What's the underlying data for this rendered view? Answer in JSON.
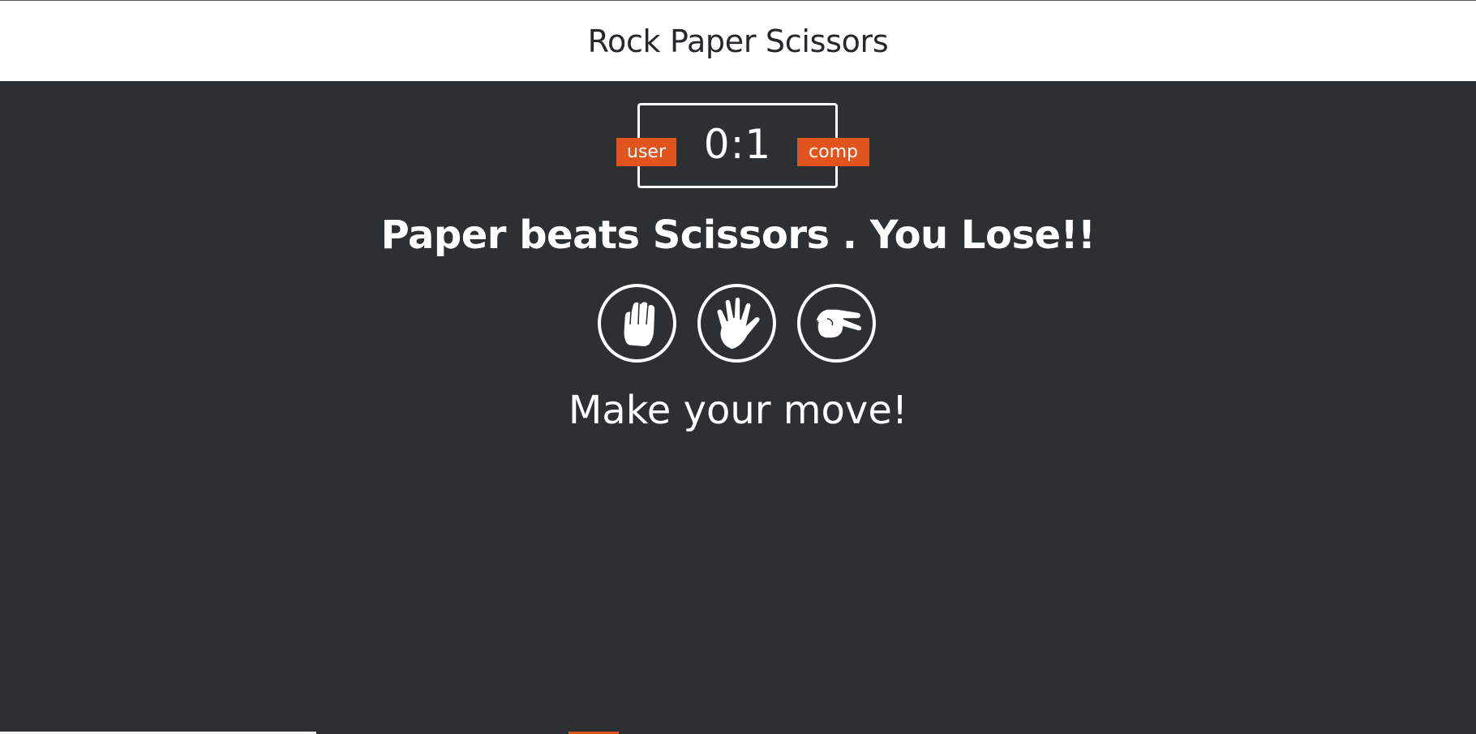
{
  "header": {
    "title": "Rock Paper Scissors"
  },
  "scoreboard": {
    "score": "0:1",
    "user_label": "user",
    "comp_label": "comp"
  },
  "result_message": "Paper beats Scissors . You Lose!!",
  "choices": [
    {
      "id": "rock",
      "icon": "rock-fist-icon"
    },
    {
      "id": "paper",
      "icon": "paper-hand-icon"
    },
    {
      "id": "scissors",
      "icon": "scissors-hand-icon"
    }
  ],
  "action_message": "Make your move!",
  "colors": {
    "background": "#2c3033",
    "header_bg": "#ffffff",
    "accent": "#e2541d",
    "text": "#ffffff"
  }
}
